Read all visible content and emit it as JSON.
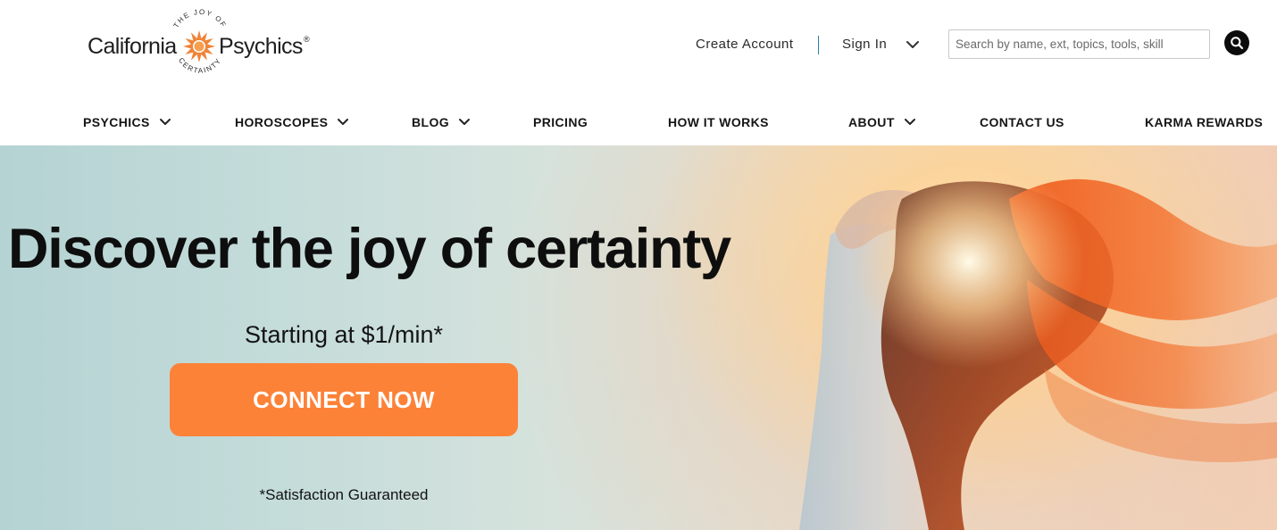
{
  "brand": {
    "name_left": "California",
    "name_right": "Psychics",
    "registered_mark": "®",
    "tagline_top": "THE JOY OF",
    "tagline_bottom": "CERTAINTY",
    "accent_color": "#f08437"
  },
  "utility": {
    "create_account": "Create Account",
    "sign_in": "Sign In",
    "search_placeholder": "Search by name, ext, topics, tools, skill"
  },
  "nav": {
    "items": [
      {
        "label": "PSYCHICS",
        "has_dropdown": true
      },
      {
        "label": "HOROSCOPES",
        "has_dropdown": true
      },
      {
        "label": "BLOG",
        "has_dropdown": true
      },
      {
        "label": "PRICING",
        "has_dropdown": false
      },
      {
        "label": "HOW IT WORKS",
        "has_dropdown": false
      },
      {
        "label": "ABOUT",
        "has_dropdown": true
      },
      {
        "label": "CONTACT US",
        "has_dropdown": false
      },
      {
        "label": "KARMA REWARDS",
        "has_dropdown": false
      }
    ]
  },
  "hero": {
    "title": "Discover the joy of certainty",
    "price_note": "Starting at $1/min*",
    "cta_label": "CONNECT NOW",
    "guarantee": "*Satisfaction Guaranteed",
    "cta_color": "#fc8238"
  },
  "icons": {
    "logo_mark": "sun-icon",
    "account_menu": "chevron-down-icon",
    "search": "search-icon",
    "nav_dropdown": "chevron-down-icon"
  }
}
